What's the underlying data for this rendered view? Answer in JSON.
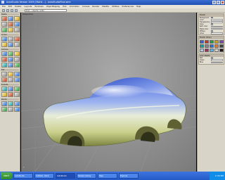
{
  "window": {
    "title": "AutoStudio Version 2009 [SN##...] - AutoStudioFinal.wire",
    "icon": "app-icon"
  },
  "menu": [
    "File",
    "Edit",
    "Delete",
    "Layouts",
    "Windows",
    "ObjectDisplay",
    "Pick",
    "Animation",
    "Canvas",
    "Render",
    "Palette",
    "Utilities",
    "Preferences",
    "Help"
  ],
  "toolbar": {
    "search_placeholder": "Find... objects / edits"
  },
  "leftpanel": {
    "sections": [
      {
        "title": "Palette",
        "icons": [
          "red",
          "blue",
          "yel",
          "gry",
          "red",
          "blue",
          "grn",
          "yel",
          "gry"
        ]
      },
      {
        "title": "Curves",
        "icons": [
          "blue",
          "gry",
          "red",
          "yel",
          "blue",
          "gry"
        ]
      },
      {
        "title": "Surfaces",
        "icons": [
          "blue",
          "grn",
          "yel",
          "red",
          "blue",
          "gry",
          "teal",
          "blue",
          "grn"
        ]
      },
      {
        "title": "Edit",
        "icons": [
          "gry",
          "yel",
          "blue",
          "red",
          "gry",
          "blue"
        ]
      },
      {
        "title": "Evaluate",
        "icons": [
          "teal",
          "blue",
          "grn",
          "yel",
          "red",
          "gry"
        ]
      },
      {
        "title": "Render",
        "icons": [
          "blue",
          "teal",
          "blue",
          "grn",
          "gry",
          "blue"
        ]
      }
    ]
  },
  "viewport": {
    "label": "Perspective",
    "axis_label": "Y"
  },
  "rightpanel": {
    "section1": {
      "title": "Shader",
      "rows": [
        "Background",
        "Color",
        "Transparency",
        "Glow",
        "Refl. Color",
        "Metal Color",
        "Diffuse",
        "Gloss"
      ]
    },
    "section2": {
      "title": "Shader Library",
      "swatches": [
        "#3b62c8",
        "#c0392b",
        "#2e9a45",
        "#d1a21e",
        "#7b4aa6",
        "#159da0",
        "#888888",
        "#2d6fcd",
        "#e07b2a",
        "#444444",
        "#b6c7e6",
        "#9c2f61",
        "#5fb0e0",
        "#d9d4c8",
        "#1a1a1a"
      ]
    },
    "section3": {
      "title": "Color Palette",
      "rows": [
        "Red",
        "Green",
        "Blue"
      ]
    }
  },
  "taskbar": {
    "start": "start",
    "tasks": [
      "AutoStudio",
      "Untitled - Paint",
      "AutoStudio",
      "Shader Library",
      "Help",
      "Explorer"
    ],
    "time": "2:30 PM"
  }
}
